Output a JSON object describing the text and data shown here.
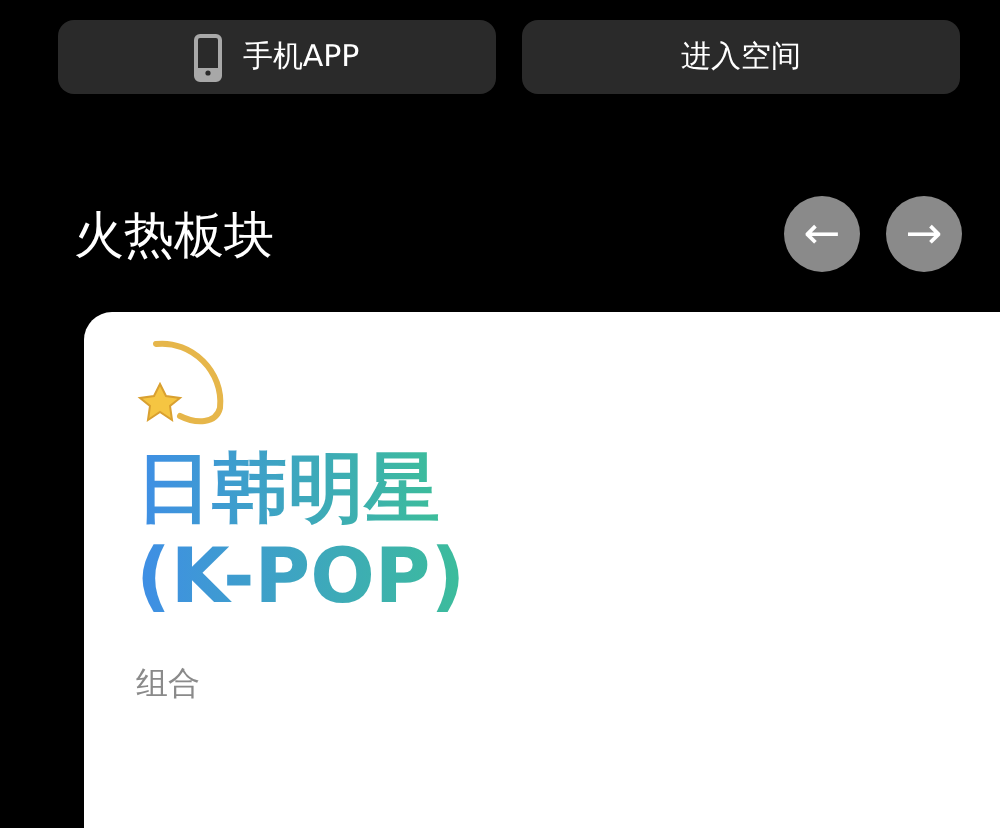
{
  "top_buttons": [
    {
      "kind": "phone",
      "label": "手机APP"
    },
    {
      "kind": "plain",
      "label": "进入空间"
    }
  ],
  "section": {
    "title": "火热板块",
    "nav": [
      {
        "label": "←"
      },
      {
        "label": "→"
      }
    ]
  },
  "card": {
    "title_lines": [
      "日韩明星",
      "(K-POP)"
    ],
    "subtitle": "组合"
  }
}
